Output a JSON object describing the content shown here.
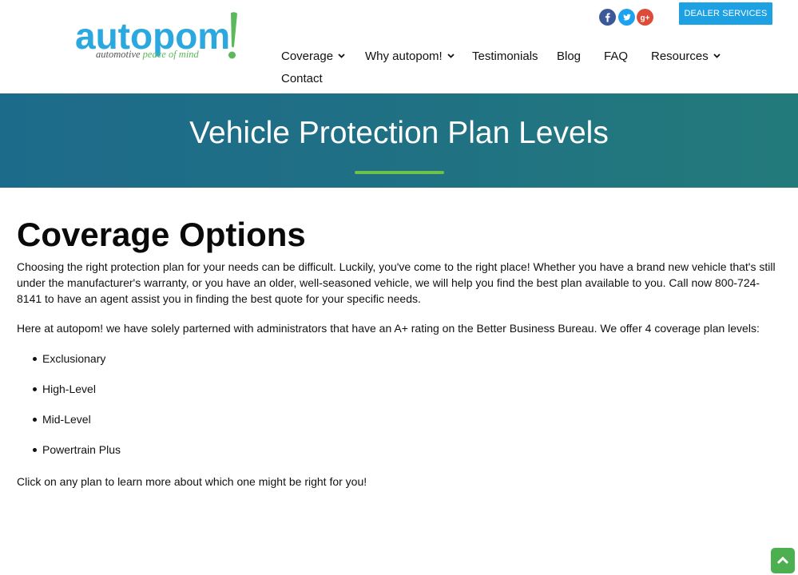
{
  "brand": {
    "name": "autopom",
    "tagline_part1": "automotive",
    "tagline_part2": "peace of mind",
    "blue": "#2aa8df",
    "green": "#5cb85c"
  },
  "social": [
    {
      "icon": "facebook-icon",
      "glyph": "f",
      "color": "#3b5998"
    },
    {
      "icon": "twitter-icon",
      "glyph": "t",
      "color": "#1da1f2"
    },
    {
      "icon": "google-plus-icon",
      "glyph": "g+",
      "color": "#dd4b39"
    }
  ],
  "dealer_button": "DEALER SERVICES",
  "nav": {
    "coverage": "Coverage",
    "why": "Why autopom!",
    "testimonials": "Testimonials",
    "blog": "Blog",
    "faq": "FAQ",
    "resources": "Resources",
    "contact": "Contact"
  },
  "banner": {
    "title": "Vehicle Protection Plan Levels",
    "bg_start": "#1d6b8a",
    "bg_end": "#237a7a",
    "rule_color": "#6cc24a"
  },
  "content": {
    "heading": "Coverage Options",
    "intro": "Choosing the right protection plan for your needs can be difficult. Luckily, you've come to the right place! Whether you have a brand new vehicle that's still under the manufacturer's warranty, or you have an older, well-seasoned vehicle, we will help you find the best plan available to you. Call now 800-724-8141 to have an agent assist you in finding the best quote for your specific needs.",
    "partners": "Here at autopom! we have solely parterned with administrators that have an A+ rating on the Better Business Bureau. We offer 4 coverage plan levels:",
    "plans": [
      "Exclusionary",
      "High-Level",
      "Mid-Level",
      "Powertrain Plus"
    ],
    "closing": "Click on any plan to learn more about which one might be right for you!"
  },
  "scroll_top": {
    "icon": "chevron-up-icon",
    "color": "#4caf50"
  }
}
